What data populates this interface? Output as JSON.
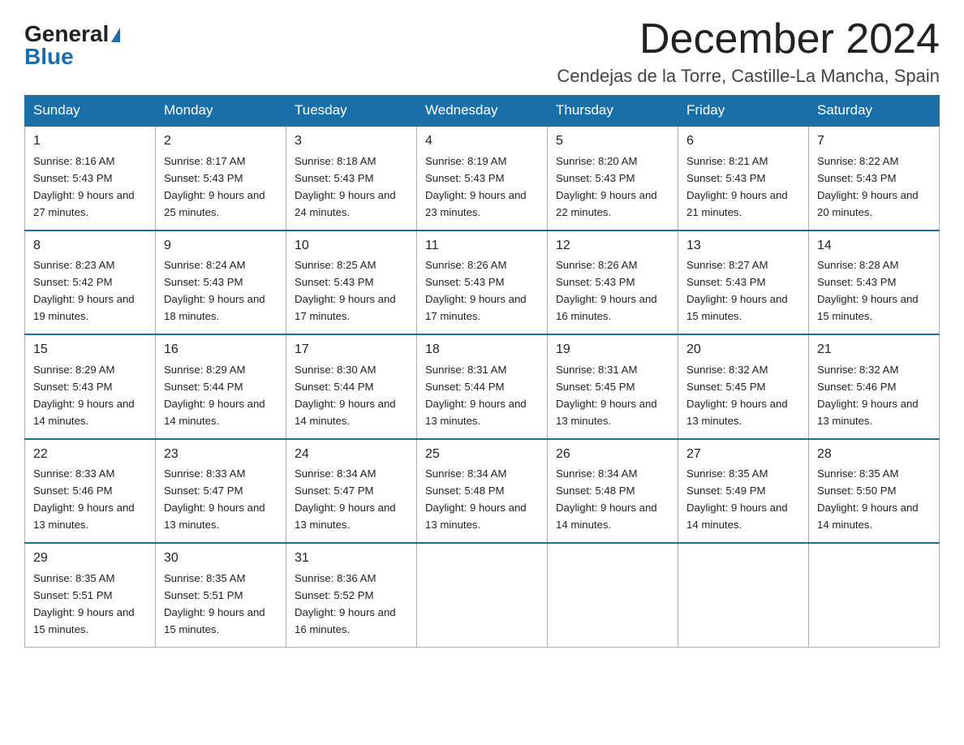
{
  "header": {
    "logo_general": "General",
    "logo_blue": "Blue",
    "month_title": "December 2024",
    "location": "Cendejas de la Torre, Castille-La Mancha, Spain"
  },
  "weekdays": [
    "Sunday",
    "Monday",
    "Tuesday",
    "Wednesday",
    "Thursday",
    "Friday",
    "Saturday"
  ],
  "weeks": [
    [
      {
        "day": "1",
        "sunrise": "Sunrise: 8:16 AM",
        "sunset": "Sunset: 5:43 PM",
        "daylight": "Daylight: 9 hours and 27 minutes."
      },
      {
        "day": "2",
        "sunrise": "Sunrise: 8:17 AM",
        "sunset": "Sunset: 5:43 PM",
        "daylight": "Daylight: 9 hours and 25 minutes."
      },
      {
        "day": "3",
        "sunrise": "Sunrise: 8:18 AM",
        "sunset": "Sunset: 5:43 PM",
        "daylight": "Daylight: 9 hours and 24 minutes."
      },
      {
        "day": "4",
        "sunrise": "Sunrise: 8:19 AM",
        "sunset": "Sunset: 5:43 PM",
        "daylight": "Daylight: 9 hours and 23 minutes."
      },
      {
        "day": "5",
        "sunrise": "Sunrise: 8:20 AM",
        "sunset": "Sunset: 5:43 PM",
        "daylight": "Daylight: 9 hours and 22 minutes."
      },
      {
        "day": "6",
        "sunrise": "Sunrise: 8:21 AM",
        "sunset": "Sunset: 5:43 PM",
        "daylight": "Daylight: 9 hours and 21 minutes."
      },
      {
        "day": "7",
        "sunrise": "Sunrise: 8:22 AM",
        "sunset": "Sunset: 5:43 PM",
        "daylight": "Daylight: 9 hours and 20 minutes."
      }
    ],
    [
      {
        "day": "8",
        "sunrise": "Sunrise: 8:23 AM",
        "sunset": "Sunset: 5:42 PM",
        "daylight": "Daylight: 9 hours and 19 minutes."
      },
      {
        "day": "9",
        "sunrise": "Sunrise: 8:24 AM",
        "sunset": "Sunset: 5:43 PM",
        "daylight": "Daylight: 9 hours and 18 minutes."
      },
      {
        "day": "10",
        "sunrise": "Sunrise: 8:25 AM",
        "sunset": "Sunset: 5:43 PM",
        "daylight": "Daylight: 9 hours and 17 minutes."
      },
      {
        "day": "11",
        "sunrise": "Sunrise: 8:26 AM",
        "sunset": "Sunset: 5:43 PM",
        "daylight": "Daylight: 9 hours and 17 minutes."
      },
      {
        "day": "12",
        "sunrise": "Sunrise: 8:26 AM",
        "sunset": "Sunset: 5:43 PM",
        "daylight": "Daylight: 9 hours and 16 minutes."
      },
      {
        "day": "13",
        "sunrise": "Sunrise: 8:27 AM",
        "sunset": "Sunset: 5:43 PM",
        "daylight": "Daylight: 9 hours and 15 minutes."
      },
      {
        "day": "14",
        "sunrise": "Sunrise: 8:28 AM",
        "sunset": "Sunset: 5:43 PM",
        "daylight": "Daylight: 9 hours and 15 minutes."
      }
    ],
    [
      {
        "day": "15",
        "sunrise": "Sunrise: 8:29 AM",
        "sunset": "Sunset: 5:43 PM",
        "daylight": "Daylight: 9 hours and 14 minutes."
      },
      {
        "day": "16",
        "sunrise": "Sunrise: 8:29 AM",
        "sunset": "Sunset: 5:44 PM",
        "daylight": "Daylight: 9 hours and 14 minutes."
      },
      {
        "day": "17",
        "sunrise": "Sunrise: 8:30 AM",
        "sunset": "Sunset: 5:44 PM",
        "daylight": "Daylight: 9 hours and 14 minutes."
      },
      {
        "day": "18",
        "sunrise": "Sunrise: 8:31 AM",
        "sunset": "Sunset: 5:44 PM",
        "daylight": "Daylight: 9 hours and 13 minutes."
      },
      {
        "day": "19",
        "sunrise": "Sunrise: 8:31 AM",
        "sunset": "Sunset: 5:45 PM",
        "daylight": "Daylight: 9 hours and 13 minutes."
      },
      {
        "day": "20",
        "sunrise": "Sunrise: 8:32 AM",
        "sunset": "Sunset: 5:45 PM",
        "daylight": "Daylight: 9 hours and 13 minutes."
      },
      {
        "day": "21",
        "sunrise": "Sunrise: 8:32 AM",
        "sunset": "Sunset: 5:46 PM",
        "daylight": "Daylight: 9 hours and 13 minutes."
      }
    ],
    [
      {
        "day": "22",
        "sunrise": "Sunrise: 8:33 AM",
        "sunset": "Sunset: 5:46 PM",
        "daylight": "Daylight: 9 hours and 13 minutes."
      },
      {
        "day": "23",
        "sunrise": "Sunrise: 8:33 AM",
        "sunset": "Sunset: 5:47 PM",
        "daylight": "Daylight: 9 hours and 13 minutes."
      },
      {
        "day": "24",
        "sunrise": "Sunrise: 8:34 AM",
        "sunset": "Sunset: 5:47 PM",
        "daylight": "Daylight: 9 hours and 13 minutes."
      },
      {
        "day": "25",
        "sunrise": "Sunrise: 8:34 AM",
        "sunset": "Sunset: 5:48 PM",
        "daylight": "Daylight: 9 hours and 13 minutes."
      },
      {
        "day": "26",
        "sunrise": "Sunrise: 8:34 AM",
        "sunset": "Sunset: 5:48 PM",
        "daylight": "Daylight: 9 hours and 14 minutes."
      },
      {
        "day": "27",
        "sunrise": "Sunrise: 8:35 AM",
        "sunset": "Sunset: 5:49 PM",
        "daylight": "Daylight: 9 hours and 14 minutes."
      },
      {
        "day": "28",
        "sunrise": "Sunrise: 8:35 AM",
        "sunset": "Sunset: 5:50 PM",
        "daylight": "Daylight: 9 hours and 14 minutes."
      }
    ],
    [
      {
        "day": "29",
        "sunrise": "Sunrise: 8:35 AM",
        "sunset": "Sunset: 5:51 PM",
        "daylight": "Daylight: 9 hours and 15 minutes."
      },
      {
        "day": "30",
        "sunrise": "Sunrise: 8:35 AM",
        "sunset": "Sunset: 5:51 PM",
        "daylight": "Daylight: 9 hours and 15 minutes."
      },
      {
        "day": "31",
        "sunrise": "Sunrise: 8:36 AM",
        "sunset": "Sunset: 5:52 PM",
        "daylight": "Daylight: 9 hours and 16 minutes."
      },
      null,
      null,
      null,
      null
    ]
  ]
}
